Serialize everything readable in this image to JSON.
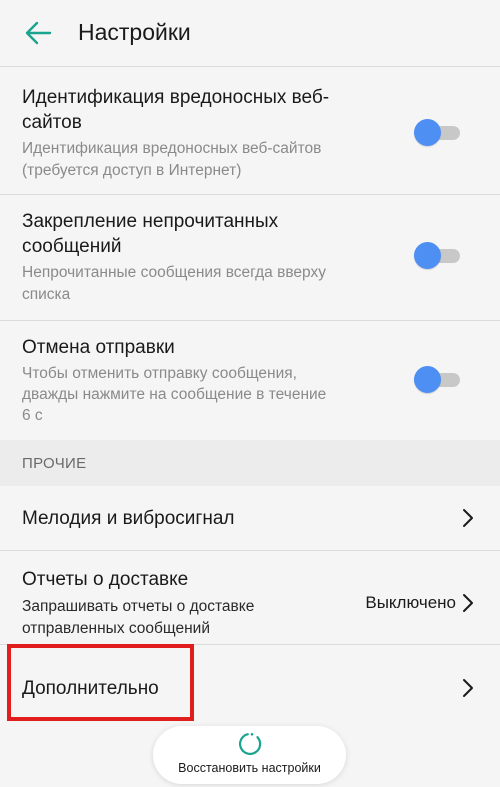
{
  "header": {
    "title": "Настройки",
    "back_icon": "arrow-left-icon",
    "accent_color": "#1aa38f"
  },
  "settings": {
    "malicious_sites": {
      "title_line1": "Идентификация вредоносных веб-",
      "title_line2": "сайтов",
      "desc_line1": "Идентификация вредоносных веб-сайтов",
      "desc_line2": "(требуется доступ в Интернет)",
      "enabled": true
    },
    "pin_unread": {
      "title_line1": "Закрепление непрочитанных",
      "title_line2": "сообщений",
      "desc_line1": "Непрочитанные сообщения всегда вверху",
      "desc_line2": "списка",
      "enabled": true
    },
    "cancel_send": {
      "title": "Отмена отправки",
      "desc_line1": "Чтобы отменить отправку сообщения,",
      "desc_line2": "дважды нажмите на сообщение в течение",
      "desc_line3": "6 с",
      "enabled": true
    }
  },
  "other_section": {
    "header": "ПРОЧИЕ",
    "ringtone": {
      "title": "Мелодия и вибросигнал"
    },
    "delivery_reports": {
      "title": "Отчеты о доставке",
      "desc_line1": "Запрашивать отчеты о доставке",
      "desc_line2": "отправленных сообщений",
      "value": "Выключено"
    },
    "advanced": {
      "title": "Дополнительно"
    }
  },
  "restore_button": {
    "label": "Восстановить настройки",
    "icon": "refresh-icon"
  },
  "colors": {
    "toggle_knob": "#4e8ff3",
    "highlight": "#e21d1d"
  }
}
